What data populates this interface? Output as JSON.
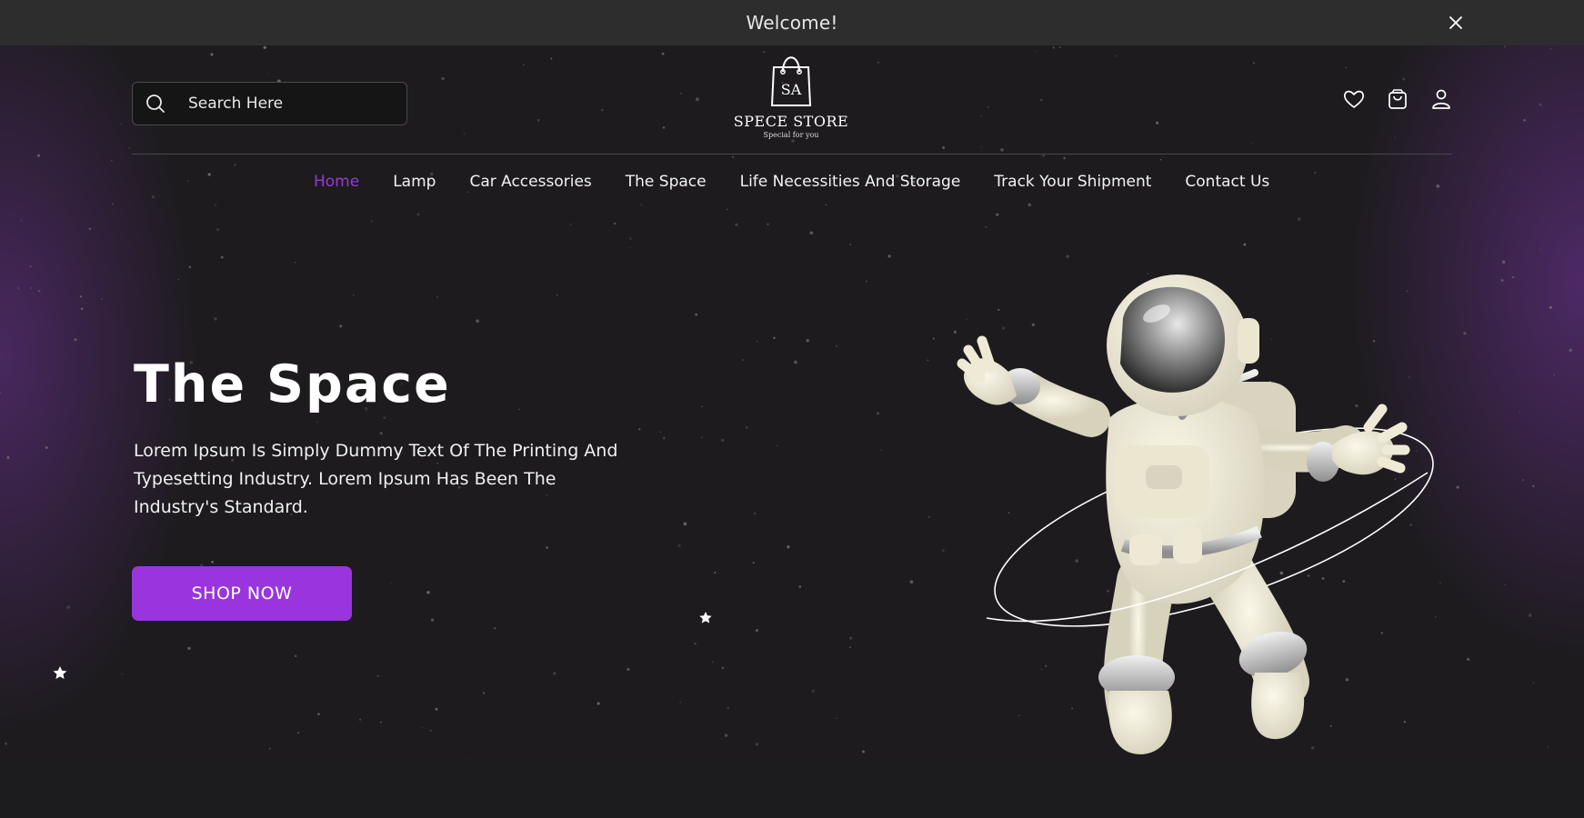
{
  "banner": {
    "text": "Welcome!",
    "close_icon": "close-icon"
  },
  "header": {
    "search": {
      "placeholder": "Search Here",
      "icon": "search-icon"
    },
    "logo": {
      "monogram": "SA",
      "name": "SPECE STORE",
      "tagline": "Special for you"
    },
    "icons": [
      "heart-icon",
      "shopping-bag-icon",
      "user-icon"
    ]
  },
  "nav": {
    "items": [
      {
        "label": "Home",
        "active": true
      },
      {
        "label": "Lamp"
      },
      {
        "label": "Car Accessories"
      },
      {
        "label": "The Space"
      },
      {
        "label": "Life Necessities And Storage"
      },
      {
        "label": "Track Your Shipment"
      },
      {
        "label": "Contact Us"
      }
    ]
  },
  "hero": {
    "title": "The Space",
    "description": "Lorem Ipsum Is Simply Dummy Text Of The Printing And Typesetting Industry. Lorem Ipsum Has Been The Industry's Standard.",
    "cta_label": "SHOP NOW"
  },
  "colors": {
    "accent": "#9a35dd",
    "active_nav": "#9b39d9",
    "background": "#1c1b1d",
    "banner": "#2d2d2e"
  }
}
